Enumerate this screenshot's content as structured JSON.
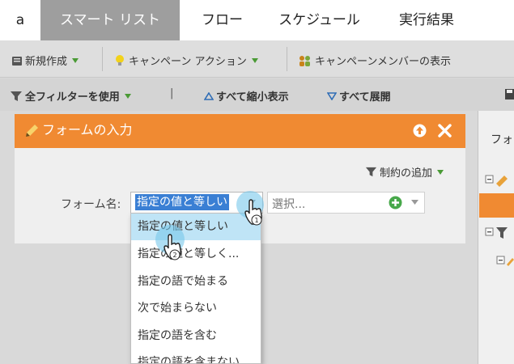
{
  "tabs": [
    {
      "label": "a"
    },
    {
      "label": "スマート リスト"
    },
    {
      "label": "フロー"
    },
    {
      "label": "スケジュール"
    },
    {
      "label": "実行結果"
    }
  ],
  "toolbar": {
    "new_label": "新規作成",
    "campaign_action_label": "キャンペーン アクション",
    "member_view_label": "キャンペーンメンバーの表示"
  },
  "filterbar": {
    "use_all_label": "全フィルターを使用",
    "separator": "|",
    "collapse_all_label": "すべて縮小表示",
    "expand_all_label": "すべて展開"
  },
  "card": {
    "title": "フォームの入力",
    "add_constraint_label": "制約の追加",
    "field_label": "フォーム名:",
    "operator_value": "指定の値と等しい",
    "value_placeholder": "選択..."
  },
  "dropdown": {
    "options": [
      "指定の値と等しい",
      "指定の値と等しく...",
      "指定の語で始まる",
      "次で始まらない",
      "指定の語を含む",
      "指定の語を含まない"
    ],
    "highlighted_index": 0
  },
  "right_panel": {
    "label": "フォ"
  },
  "cursor_steps": [
    "1",
    "2"
  ],
  "colors": {
    "accent_orange": "#f08a32",
    "active_tab": "#9e9e9e",
    "selection_blue": "#3a7fd4",
    "highlight": "#bfe4f6",
    "caret_green": "#4a9a35"
  }
}
